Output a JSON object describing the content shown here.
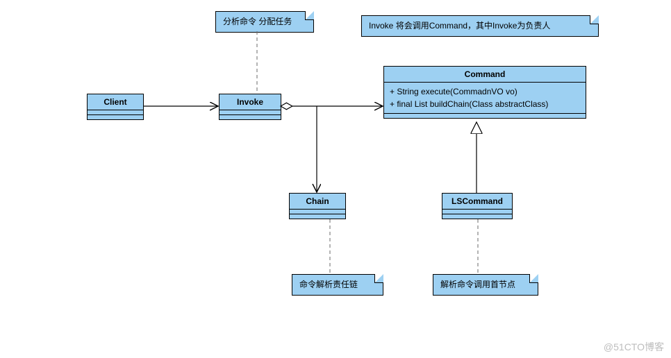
{
  "notes": {
    "invoke_note": "分析命令 分配任务",
    "top_note": "Invoke 将会调用Command，其中Invoke为负责人",
    "chain_note": "命令解析责任链",
    "lscommand_note": "解析命令调用首节点"
  },
  "classes": {
    "client": {
      "name": "Client"
    },
    "invoke": {
      "name": "Invoke"
    },
    "command": {
      "name": "Command",
      "method1": "+ String execute(CommadnVO vo)",
      "method2": "+ final List buildChain(Class abstractClass)"
    },
    "chain": {
      "name": "Chain"
    },
    "lscommand": {
      "name": "LSCommand"
    }
  },
  "relations": {
    "client_to_invoke": "association-arrow",
    "invoke_to_command": "aggregation-arrow",
    "invoke_to_chain": "association-arrow",
    "lscommand_to_command": "generalization"
  },
  "colors": {
    "fill": "#9dd0f2",
    "stroke": "#000000",
    "dash": "#6a6a6a"
  },
  "watermark": "@51CTO博客"
}
